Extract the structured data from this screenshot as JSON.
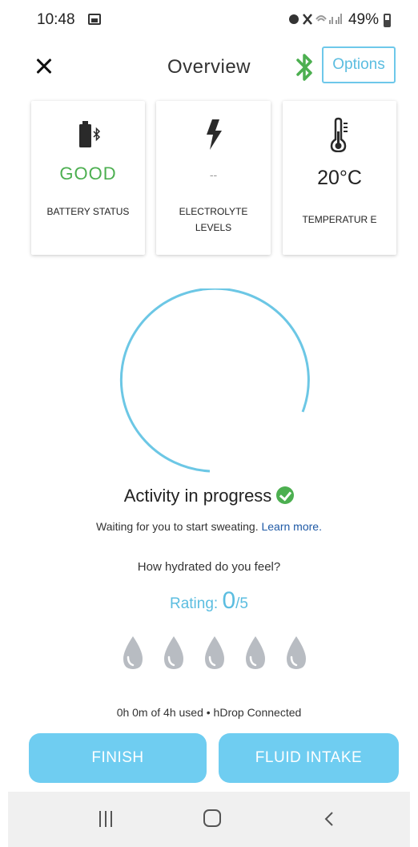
{
  "status_bar": {
    "time": "10:48",
    "right_icons": "⏰🔇📶",
    "battery_percent": "49%"
  },
  "header": {
    "title": "Overview",
    "options_label": "Options",
    "bluetooth_color": "#4caf50"
  },
  "cards": [
    {
      "icon": "battery-bluetooth-icon",
      "value": "GOOD",
      "label": "BATTERY STATUS"
    },
    {
      "icon": "lightning-icon",
      "value": "--",
      "label": "ELECTROLYTE LEVELS"
    },
    {
      "icon": "thermometer-icon",
      "value": "20°C",
      "label": "TEMPERATUR E"
    }
  ],
  "activity": {
    "title": "Activity in progress",
    "subtitle": "Waiting for you to start sweating.",
    "learn_more": "Learn more."
  },
  "hydration": {
    "question": "How hydrated do you feel?",
    "rating_label": "Rating:",
    "rating_value": "0",
    "rating_max": "/5",
    "drops_count": 5
  },
  "usage": "0h 0m of 4h used • hDrop Connected",
  "buttons": {
    "finish": "FINISH",
    "fluid_intake": "FLUID INTAKE"
  },
  "colors": {
    "accent": "#6fcdf1",
    "good": "#4caf50",
    "drop": "#b8bcc2"
  }
}
